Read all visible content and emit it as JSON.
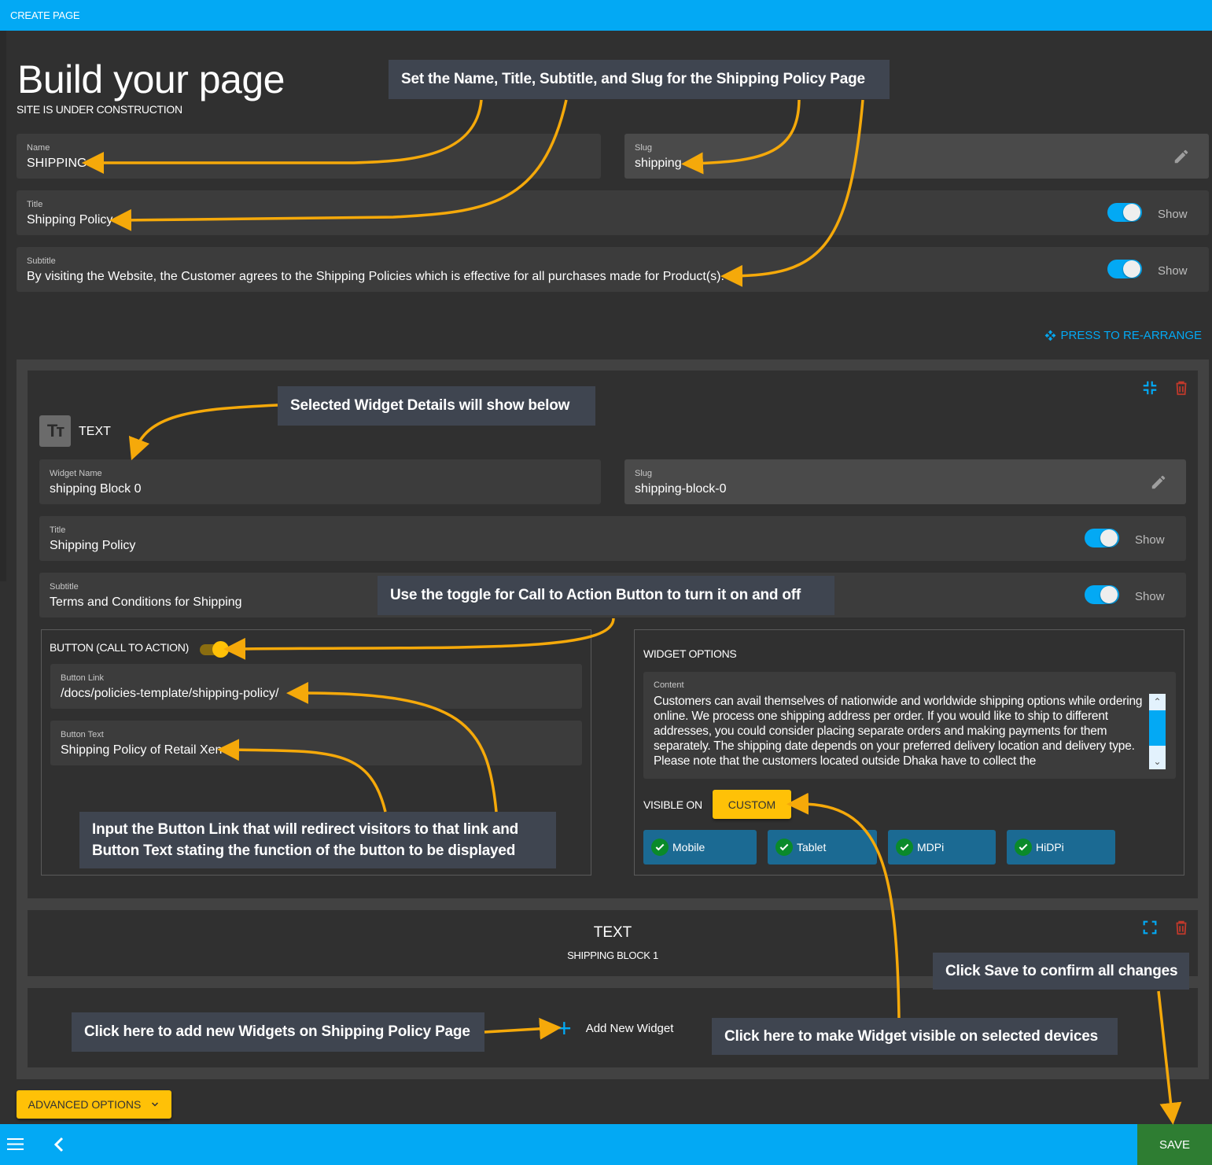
{
  "topbar": {
    "title": "CREATE PAGE"
  },
  "header": {
    "title": "Build your page",
    "subtitle": "SITE IS UNDER CONSTRUCTION"
  },
  "page_fields": {
    "name": {
      "label": "Name",
      "value": "SHIPPING"
    },
    "slug": {
      "label": "Slug",
      "value": "shipping",
      "edit_icon": "pencil-icon"
    },
    "title": {
      "label": "Title",
      "value": "Shipping Policy",
      "toggle_on": true,
      "toggle_label": "Show"
    },
    "subtitle": {
      "label": "Subtitle",
      "value": "By visiting the Website, the Customer agrees to the Shipping Policies which is effective for all purchases made for Product(s).",
      "toggle_on": true,
      "toggle_label": "Show"
    }
  },
  "rearrange": {
    "label": "PRESS TO RE-ARRANGE",
    "icon": "move-icon"
  },
  "widget_selected": {
    "type_label": "TEXT",
    "type_icon": "text-type-icon",
    "collapse_icon": "collapse-icon",
    "delete_icon": "trash-icon",
    "widget_name": {
      "label": "Widget Name",
      "value": "shipping Block 0"
    },
    "slug": {
      "label": "Slug",
      "value": "shipping-block-0"
    },
    "title": {
      "label": "Title",
      "value": "Shipping Policy",
      "toggle_on": true,
      "toggle_label": "Show"
    },
    "subtitle": {
      "label": "Subtitle",
      "value": "Terms and Conditions for Shipping",
      "toggle_on": true,
      "toggle_label": "Show"
    },
    "cta": {
      "title": "BUTTON (CALL TO ACTION)",
      "toggle_on": true,
      "button_link": {
        "label": "Button Link",
        "value": "/docs/policies-template/shipping-policy/"
      },
      "button_text": {
        "label": "Button Text",
        "value": "Shipping Policy of Retail Xen"
      }
    },
    "options": {
      "title": "WIDGET OPTIONS",
      "content": {
        "label": "Content",
        "value": "Customers can avail themselves of nationwide and worldwide shipping options while ordering online. We process one shipping address per order. If you would like to ship to different addresses, you could consider placing separate orders and making payments for them separately. The shipping date depends on your preferred delivery location and delivery type. Please note that the customers located outside Dhaka have to collect the"
      },
      "visible_on_label": "VISIBLE ON",
      "visible_on_value": "CUSTOM",
      "devices": [
        {
          "label": "Mobile",
          "checked": true
        },
        {
          "label": "Tablet",
          "checked": true
        },
        {
          "label": "MDPi",
          "checked": true
        },
        {
          "label": "HiDPi",
          "checked": true
        }
      ]
    }
  },
  "widget_collapsed": {
    "type_label": "TEXT",
    "name": "SHIPPING BLOCK 1",
    "expand_icon": "expand-icon",
    "delete_icon": "trash-icon"
  },
  "add_widget": {
    "label": "Add New Widget",
    "icon": "plus-icon"
  },
  "advanced_options": {
    "label": "ADVANCED OPTIONS",
    "icon": "chevron-down-icon"
  },
  "bottombar": {
    "menu_icon": "menu-icon",
    "back_icon": "chevron-left-icon",
    "save_label": "SAVE"
  },
  "colors": {
    "accent": "#03a9f4",
    "warning": "#ffc107",
    "save": "#2e7d32",
    "danger": "#c0392b",
    "annotation_arrow": "#f5a90a"
  },
  "annotations": {
    "a1": "Set the Name, Title, Subtitle, and Slug for the Shipping Policy Page",
    "a2": "Selected Widget Details will show below",
    "a3": "Use the toggle for Call to Action Button to turn it on and off",
    "a4": "Input the Button Link that will redirect visitors to that link and Button Text stating the function of the button to be displayed",
    "a5": "Click Save to confirm all changes",
    "a6": "Click here to add new Widgets on Shipping Policy Page",
    "a7": "Click here to make Widget visible on selected devices"
  }
}
